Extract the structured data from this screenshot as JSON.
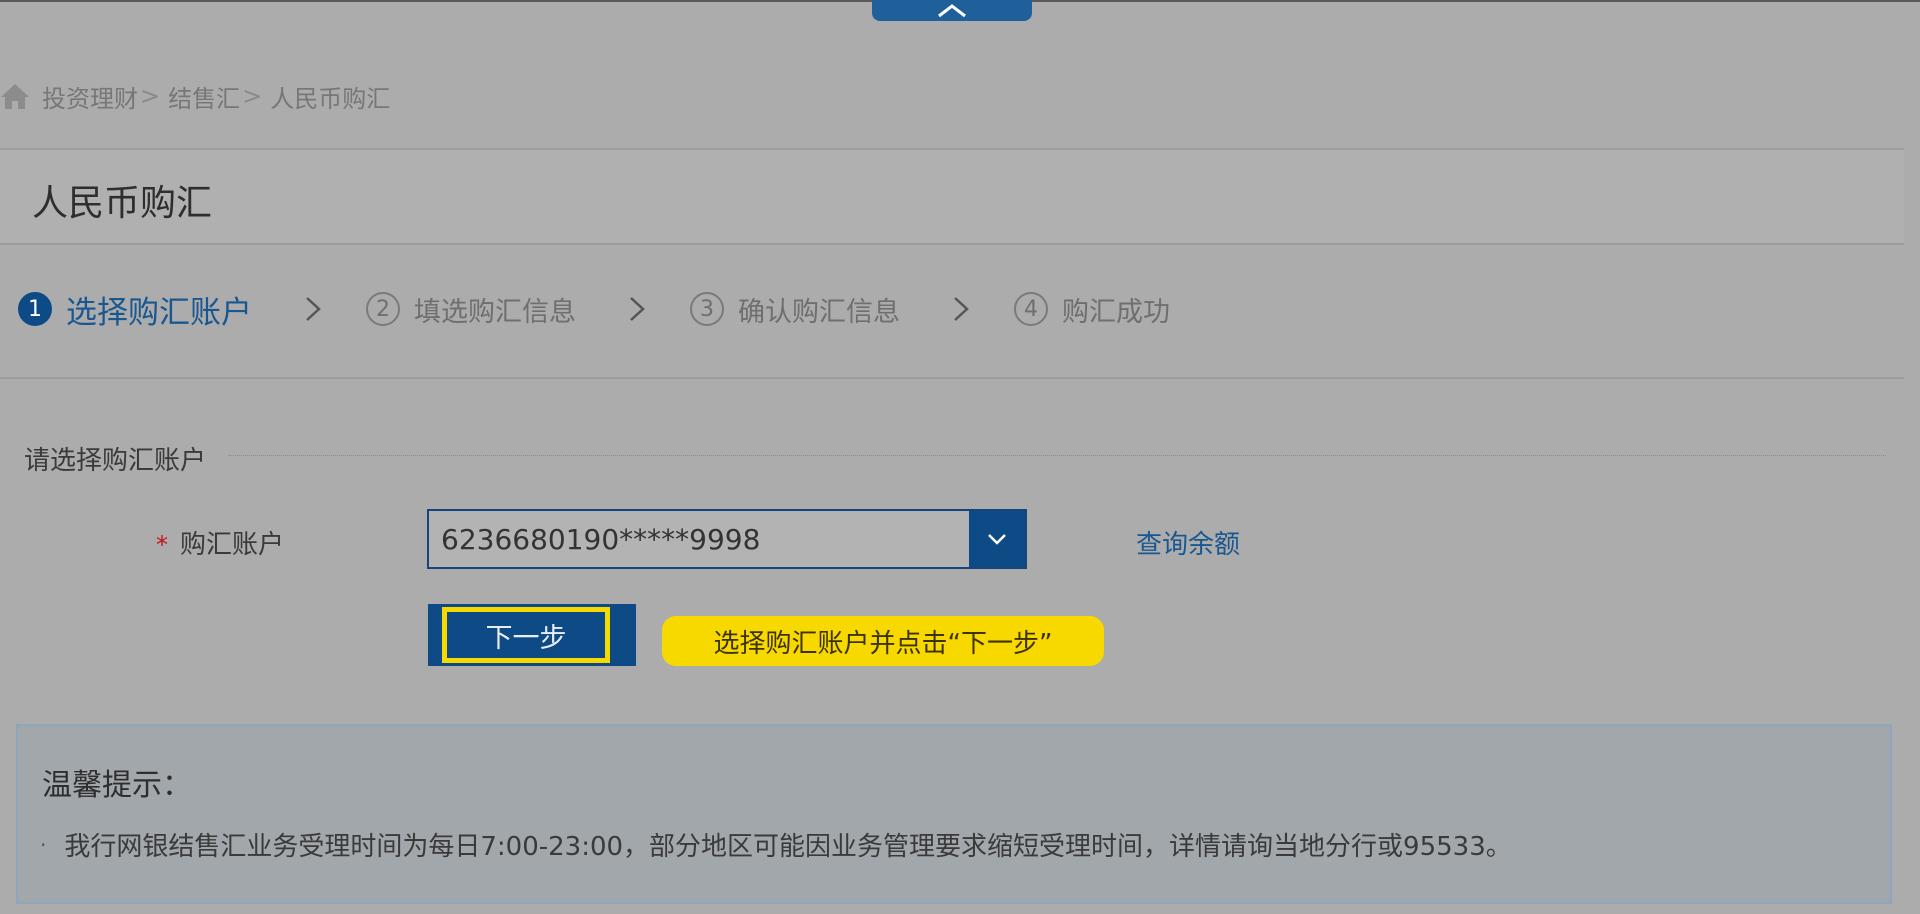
{
  "breadcrumb": {
    "items": [
      "投资理财",
      "结售汇",
      "人民币购汇"
    ],
    "separator": ">"
  },
  "page_title": "人民币购汇",
  "steps": [
    {
      "number": "1",
      "label": "选择购汇账户",
      "active": true
    },
    {
      "number": "2",
      "label": "填选购汇信息",
      "active": false
    },
    {
      "number": "3",
      "label": "确认购汇信息",
      "active": false
    },
    {
      "number": "4",
      "label": "购汇成功",
      "active": false
    }
  ],
  "section": {
    "title": "请选择购汇账户"
  },
  "account_field": {
    "required_mark": "*",
    "label": "购汇账户",
    "value": "6236680190*****9998"
  },
  "balance_link": "查询余额",
  "next_button": "下一步",
  "hint": "选择购汇账户并点击“下一步”",
  "notice": {
    "title": "温馨提示：",
    "items": [
      "我行网银结售汇业务受理时间为每日7:00-23:00，部分地区可能因业务管理要求缩短受理时间，详情请询当地分行或95533。"
    ]
  },
  "colors": {
    "primary": "#0e4a86",
    "highlight": "#f7d900",
    "required": "#c0141c",
    "link": "#1a5791"
  },
  "icons": {
    "collapse": "chevron-up-icon",
    "home": "home-icon",
    "step_separator": "chevron-right-icon",
    "dropdown": "chevron-down-icon"
  }
}
